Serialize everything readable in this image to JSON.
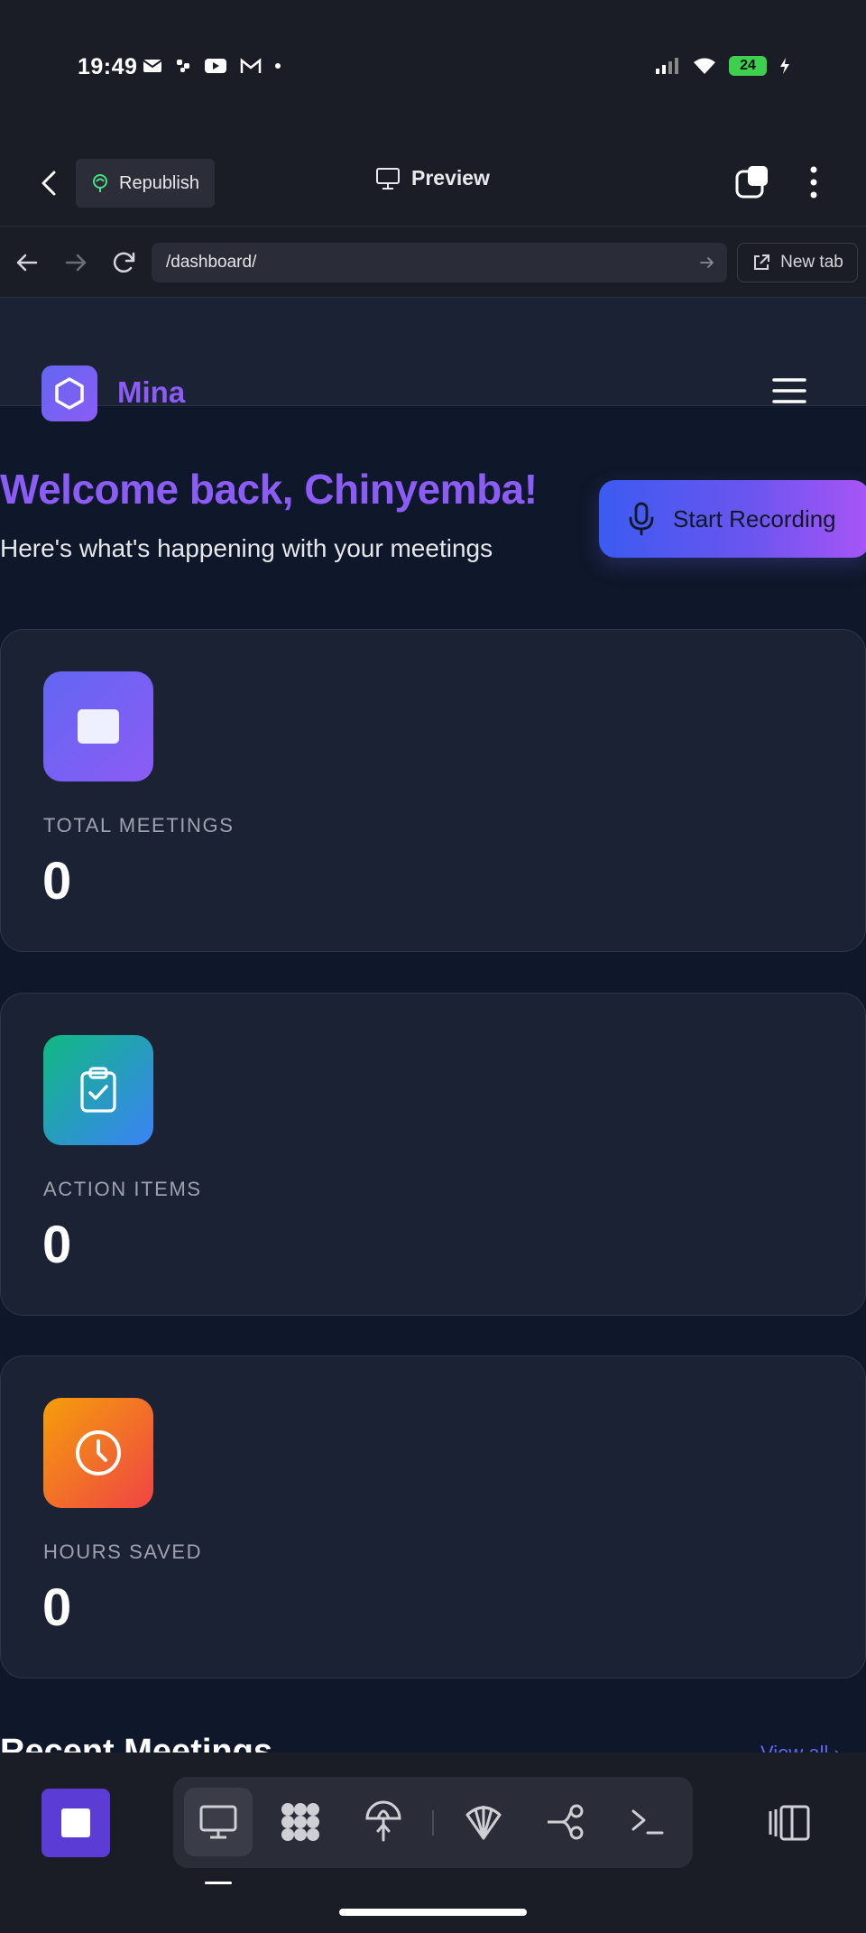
{
  "status_bar": {
    "time": "19:49",
    "battery": "24",
    "left_icons": [
      "mail-icon",
      "slack-icon",
      "youtube-icon",
      "gmail-icon",
      "dot-icon"
    ],
    "right_icons": [
      "signal-icon",
      "wifi-icon",
      "battery-icon",
      "charging-icon"
    ]
  },
  "topbar": {
    "republish_label": "Republish",
    "preview_label": "Preview"
  },
  "browser": {
    "url": "/dashboard/",
    "new_tab_label": "New tab"
  },
  "site": {
    "brand": "Mina",
    "welcome": "Welcome back, Chinyemba!",
    "subtitle": "Here's what's happening with your meetings",
    "record_label": "Start Recording",
    "stats": [
      {
        "label": "TOTAL MEETINGS",
        "value": "0",
        "icon": "stop-square-icon",
        "color_from": "#6366f1",
        "color_to": "#8b5cf6"
      },
      {
        "label": "ACTION ITEMS",
        "value": "0",
        "icon": "clipboard-check-icon",
        "color_from": "#10b981",
        "color_to": "#3b82f6"
      },
      {
        "label": "HOURS SAVED",
        "value": "0",
        "icon": "clock-icon",
        "color_from": "#f59e0b",
        "color_to": "#ef4444"
      }
    ],
    "recent_title": "Recent Meetings",
    "view_all_label": "View all"
  },
  "colors": {
    "accent": "#8b5cf6",
    "page_bg": "#0f172a",
    "card_bg": "#1b2234"
  },
  "toolbar": {
    "tools": [
      "monitor-icon",
      "apps-grid-icon",
      "parachute-icon",
      "shell-icon",
      "branch-icon",
      "terminal-icon"
    ]
  }
}
